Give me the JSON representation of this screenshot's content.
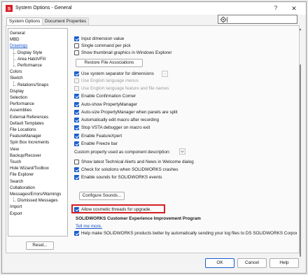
{
  "window": {
    "title": "System Options - General",
    "help_glyph": "?",
    "close_glyph": "✕"
  },
  "tabs": [
    "System Options",
    "Document Properties"
  ],
  "search": {
    "placeholder": "",
    "value": ""
  },
  "tree": {
    "items": [
      {
        "label": "General",
        "level": 0,
        "selected": false
      },
      {
        "label": "MBD",
        "level": 0,
        "selected": false
      },
      {
        "label": "Drawings",
        "level": 0,
        "selected": true
      },
      {
        "label": "Display Style",
        "level": 1,
        "selected": false
      },
      {
        "label": "Area Hatch/Fill",
        "level": 1,
        "selected": false
      },
      {
        "label": "Performance",
        "level": 1,
        "selected": false
      },
      {
        "label": "Colors",
        "level": 0,
        "selected": false
      },
      {
        "label": "Sketch",
        "level": 0,
        "selected": false
      },
      {
        "label": "Relations/Snaps",
        "level": 1,
        "selected": false
      },
      {
        "label": "Display",
        "level": 0,
        "selected": false
      },
      {
        "label": "Selection",
        "level": 0,
        "selected": false
      },
      {
        "label": "Performance",
        "level": 0,
        "selected": false
      },
      {
        "label": "Assemblies",
        "level": 0,
        "selected": false
      },
      {
        "label": "External References",
        "level": 0,
        "selected": false
      },
      {
        "label": "Default Templates",
        "level": 0,
        "selected": false
      },
      {
        "label": "File Locations",
        "level": 0,
        "selected": false
      },
      {
        "label": "FeatureManager",
        "level": 0,
        "selected": false
      },
      {
        "label": "Spin Box Increments",
        "level": 0,
        "selected": false
      },
      {
        "label": "View",
        "level": 0,
        "selected": false
      },
      {
        "label": "Backup/Recover",
        "level": 0,
        "selected": false
      },
      {
        "label": "Touch",
        "level": 0,
        "selected": false
      },
      {
        "label": "Hole Wizard/Toolbox",
        "level": 0,
        "selected": false
      },
      {
        "label": "File Explorer",
        "level": 0,
        "selected": false
      },
      {
        "label": "Search",
        "level": 0,
        "selected": false
      },
      {
        "label": "Collaboration",
        "level": 0,
        "selected": false
      },
      {
        "label": "Messages/Errors/Warnings",
        "level": 0,
        "selected": false
      },
      {
        "label": "Dismissed Messages",
        "level": 1,
        "selected": false
      },
      {
        "label": "Import",
        "level": 0,
        "selected": false
      },
      {
        "label": "Export",
        "level": 0,
        "selected": false
      }
    ],
    "reset_label": "Reset..."
  },
  "options": {
    "input_dimension_value": {
      "label": "Input dimension value",
      "checked": true,
      "enabled": true
    },
    "single_command_per_pick": {
      "label": "Single command per pick",
      "checked": false,
      "enabled": true
    },
    "show_thumbnail": {
      "label": "Show thumbnail graphics in Windows Explorer",
      "checked": false,
      "enabled": true
    },
    "restore_file_associations": "Restore File Associations",
    "use_system_separator": {
      "label": "Use system separator for dimensions",
      "checked": true,
      "enabled": true
    },
    "separator_value": ".",
    "use_english_menus": {
      "label": "Use English language menus",
      "checked": false,
      "enabled": false
    },
    "use_english_feature_names": {
      "label": "Use English language feature and file names",
      "checked": false,
      "enabled": false
    },
    "enable_confirmation_corner": {
      "label": "Enable Confirmation Corner",
      "checked": true,
      "enabled": true
    },
    "auto_show_propertymanager": {
      "label": "Auto-show PropertyManager",
      "checked": true,
      "enabled": true
    },
    "auto_size_propertymanager": {
      "label": "Auto-size PropertyManager when panels are split",
      "checked": true,
      "enabled": true
    },
    "auto_edit_macro": {
      "label": "Automatically edit macro after recording",
      "checked": true,
      "enabled": true
    },
    "stop_vsta_debugger": {
      "label": "Stop VSTA debugger on macro exit",
      "checked": true,
      "enabled": true
    },
    "enable_featurexpert": {
      "label": "Enable FeatureXpert",
      "checked": true,
      "enabled": true
    },
    "enable_freeze_bar": {
      "label": "Enable Freeze bar",
      "checked": true,
      "enabled": true
    },
    "custom_property_label": "Custom property used as component description:",
    "show_latest_news": {
      "label": "Show latest Technical Alerts and News in Welcome dialog",
      "checked": false,
      "enabled": true
    },
    "check_for_solutions": {
      "label": "Check for solutions when SOLIDWORKS crashes",
      "checked": true,
      "enabled": true
    },
    "enable_sounds": {
      "label": "Enable sounds for SOLIDWORKS events",
      "checked": true,
      "enabled": true
    },
    "configure_sounds": "Configure Sounds...",
    "allow_cosmetic_threads": {
      "label": "Allow cosmetic threads for upgrade.",
      "checked": true,
      "enabled": true
    },
    "ceip_heading": "SOLIDWORKS Customer Experience Improvement Program",
    "tell_me_more": "Tell me more.",
    "help_make_better": {
      "label": "Help make SOLIDWORKS products better by automatically sending your log files to DS SOLIDWORKS Corporation",
      "checked": true,
      "enabled": true
    }
  },
  "footer": {
    "ok": "OK",
    "cancel": "Cancel",
    "help": "Help"
  },
  "colors": {
    "accent": "#1a5fd0",
    "highlight_box": "#d61f26",
    "link": "#1a56c8"
  }
}
